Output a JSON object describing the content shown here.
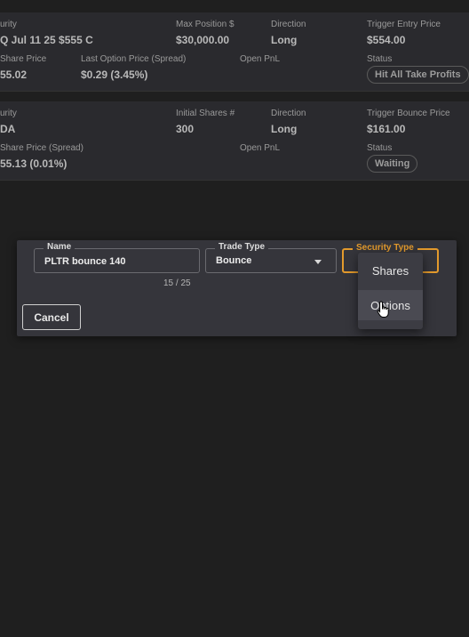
{
  "cards": [
    {
      "row1": [
        {
          "label": "urity",
          "value": "Q Jul 11 25 $555 C"
        },
        {
          "label": "Max Position $",
          "value": "$30,000.00"
        },
        {
          "label": "Direction",
          "value": "Long"
        },
        {
          "label": "Trigger Entry Price",
          "value": "$554.00"
        }
      ],
      "row2": [
        {
          "label": "Share Price",
          "value": "55.02"
        },
        {
          "label": "Last Option Price (Spread)",
          "value": "$0.29 (3.45%)"
        },
        {
          "label": "Open PnL",
          "value": ""
        },
        {
          "label": "Status",
          "value": "Hit All Take Profits"
        }
      ]
    },
    {
      "row1": [
        {
          "label": "urity",
          "value": "DA"
        },
        {
          "label": "Initial Shares #",
          "value": "300"
        },
        {
          "label": "Direction",
          "value": "Long"
        },
        {
          "label": "Trigger Bounce Price",
          "value": "$161.00"
        }
      ],
      "row2": [
        {
          "label": "Share Price (Spread)",
          "value": "55.13 (0.01%)"
        },
        {
          "label": "Open PnL",
          "value": ""
        },
        {
          "label": "Status",
          "value": "Waiting"
        }
      ]
    }
  ],
  "dialog": {
    "name_label": "Name",
    "name_value": "PLTR bounce 140",
    "char_counter": "15 / 25",
    "trade_type_label": "Trade Type",
    "trade_type_value": "Bounce",
    "security_type_label": "Security Type",
    "security_type_value": "",
    "cancel_label": "Cancel"
  },
  "dropdown": {
    "options": [
      "Shares",
      "Options"
    ],
    "hovered": "Options"
  },
  "colors": {
    "accent": "#e39a2c",
    "background": "#1f1f1f",
    "card": "#2a2a2e",
    "dialog": "#35353b"
  }
}
